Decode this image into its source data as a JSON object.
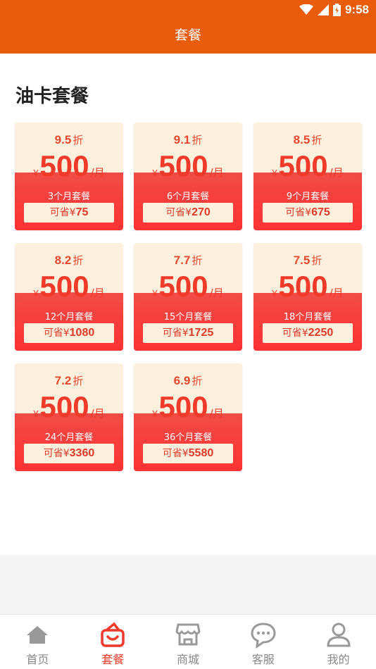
{
  "status": {
    "time": "9:58"
  },
  "appbar": {
    "title": "套餐"
  },
  "section": {
    "title": "油卡套餐"
  },
  "currency": "¥",
  "unit": "/月",
  "zhe": "折",
  "save_prefix": "可省",
  "plans": [
    {
      "discount": "9.5",
      "price": "500",
      "package": "3个月套餐",
      "save": "75"
    },
    {
      "discount": "9.1",
      "price": "500",
      "package": "6个月套餐",
      "save": "270"
    },
    {
      "discount": "8.5",
      "price": "500",
      "package": "9个月套餐",
      "save": "675"
    },
    {
      "discount": "8.2",
      "price": "500",
      "package": "12个月套餐",
      "save": "1080"
    },
    {
      "discount": "7.7",
      "price": "500",
      "package": "15个月套餐",
      "save": "1725"
    },
    {
      "discount": "7.5",
      "price": "500",
      "package": "18个月套餐",
      "save": "2250"
    },
    {
      "discount": "7.2",
      "price": "500",
      "package": "24个月套餐",
      "save": "3360"
    },
    {
      "discount": "6.9",
      "price": "500",
      "package": "36个月套餐",
      "save": "5580"
    }
  ],
  "tabs": [
    {
      "label": "首页",
      "icon": "home-icon",
      "active": false
    },
    {
      "label": "套餐",
      "icon": "package-bag-icon",
      "active": true
    },
    {
      "label": "商城",
      "icon": "store-icon",
      "active": false
    },
    {
      "label": "客服",
      "icon": "chat-icon",
      "active": false
    },
    {
      "label": "我的",
      "icon": "user-icon",
      "active": false
    }
  ],
  "colors": {
    "brand": "#e85c0b",
    "accent": "#f23a2a",
    "card_bg": "#fdf0dd"
  }
}
